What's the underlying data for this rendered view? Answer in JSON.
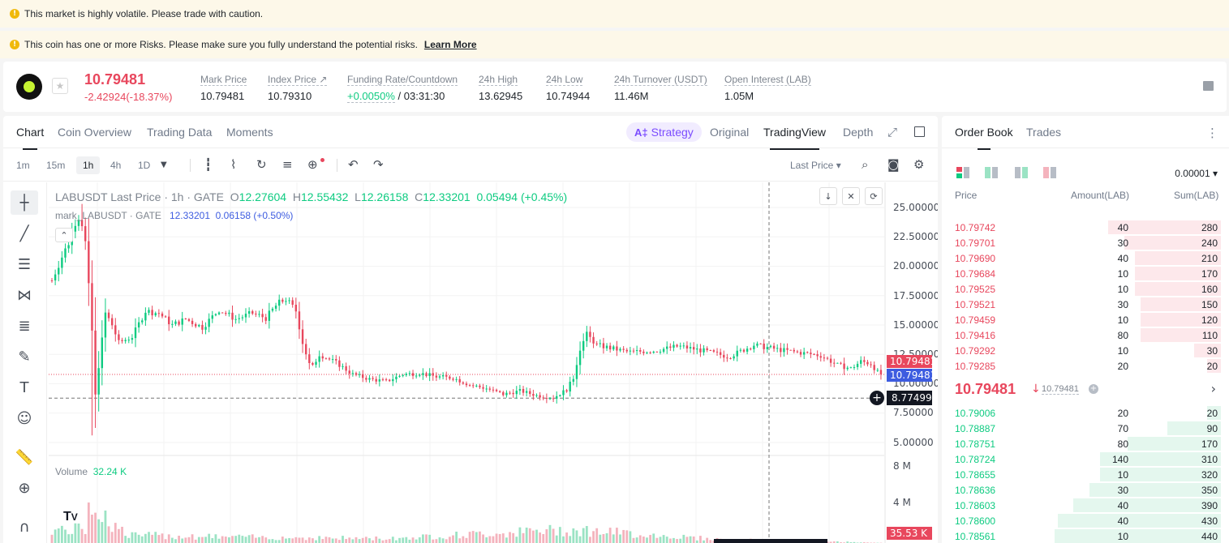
{
  "banners": {
    "volatility": "This market is highly volatile. Please trade with caution.",
    "risk": "This coin has one or more Risks. Please make sure you fully understand the potential risks.",
    "learn_more": "Learn More",
    "warn_icon": "!"
  },
  "ticker": {
    "last_price": "10.79481",
    "change": "-2.42924(-18.37%)",
    "stats": [
      {
        "label": "Mark Price",
        "value": "10.79481"
      },
      {
        "label": "Index Price ↗",
        "value": "10.79310"
      },
      {
        "label": "Funding Rate/Countdown",
        "value_rate": "+0.0050%",
        "value_countdown": "/ 03:31:30"
      },
      {
        "label": "24h High",
        "value": "13.62945"
      },
      {
        "label": "24h Low",
        "value": "10.74944"
      },
      {
        "label": "24h Turnover (USDT)",
        "value": "11.46M"
      },
      {
        "label": "Open Interest (LAB)",
        "value": "1.05M"
      }
    ],
    "star_icon": "★"
  },
  "chart_tabs": {
    "items": [
      "Chart",
      "Coin Overview",
      "Trading Data",
      "Moments"
    ],
    "strategy_ai": "A‡",
    "strategy": "Strategy",
    "views": [
      "Original",
      "TradingView",
      "Depth"
    ]
  },
  "toolbar": {
    "timeframes": [
      "1m",
      "15m",
      "1h",
      "4h",
      "1D"
    ],
    "active_timeframe": "1h",
    "price_type": "Last Price ▾"
  },
  "legend": {
    "symbol": "LABUSDT Last Price · 1h · GATE",
    "o_label": "O",
    "o": "12.27604",
    "h_label": "H",
    "h": "12.55432",
    "l_label": "L",
    "l": "12.26158",
    "c_label": "C",
    "c": "12.33201",
    "chg": "0.05494 (+0.45%)",
    "mark_symbol": "mark_LABUSDT · GATE",
    "mark_value": "12.33201",
    "mark_chg": "0.06158 (+0.50%)",
    "volume_label": "Volume",
    "volume_value": "32.24 K"
  },
  "axis": {
    "price_ticks": [
      "25.00000",
      "22.50000",
      "20.00000",
      "17.50000",
      "15.00000",
      "12.50000",
      "10.00000",
      "7.50000",
      "5.00000"
    ],
    "volume_ticks": [
      "8 M",
      "4 M"
    ],
    "last_price_tag": "10.79481",
    "mark_price_tag": "10.79481",
    "crosshair_tag": "8.77499",
    "volume_tag": "35.53 K"
  },
  "colors": {
    "up": "#0ecb81",
    "down": "#e8475d",
    "mark": "#3d5ce0"
  },
  "chart_data": {
    "type": "candlestick",
    "symbol": "LABUSDT",
    "interval": "1h",
    "ylim": [
      3.5,
      27.0
    ],
    "volume_ylim": [
      0,
      10000000
    ],
    "last_price": 10.79481,
    "crosshair_price": 8.77499,
    "last_candle": {
      "open": 12.27604,
      "high": 12.55432,
      "low": 12.26158,
      "close": 12.33201
    },
    "series_outline": [
      [
        0,
        18.8
      ],
      [
        5,
        20.5
      ],
      [
        10,
        22.0
      ],
      [
        14,
        23.8
      ],
      [
        17,
        24.5
      ],
      [
        20,
        22.0
      ],
      [
        24,
        14.5
      ],
      [
        26,
        9.0
      ],
      [
        28,
        11.5
      ],
      [
        32,
        16.0
      ],
      [
        36,
        15.0
      ],
      [
        40,
        13.5
      ],
      [
        48,
        14.0
      ],
      [
        56,
        16.2
      ],
      [
        64,
        16.0
      ],
      [
        72,
        15.0
      ],
      [
        80,
        15.5
      ],
      [
        90,
        14.8
      ],
      [
        100,
        16.3
      ],
      [
        110,
        15.5
      ],
      [
        120,
        16.0
      ],
      [
        128,
        15.6
      ],
      [
        135,
        16.8
      ],
      [
        140,
        17.2
      ],
      [
        146,
        16.2
      ],
      [
        150,
        13.5
      ],
      [
        155,
        11.2
      ],
      [
        160,
        12.5
      ],
      [
        170,
        11.8
      ],
      [
        180,
        10.8
      ],
      [
        190,
        10.4
      ],
      [
        200,
        10.2
      ],
      [
        210,
        10.8
      ],
      [
        220,
        10.9
      ],
      [
        230,
        10.6
      ],
      [
        240,
        10.5
      ],
      [
        250,
        9.9
      ],
      [
        260,
        9.6
      ],
      [
        270,
        9.1
      ],
      [
        280,
        9.4
      ],
      [
        290,
        9.0
      ],
      [
        300,
        8.8
      ],
      [
        308,
        9.5
      ],
      [
        312,
        10.5
      ],
      [
        316,
        13.0
      ],
      [
        320,
        14.2
      ],
      [
        326,
        13.3
      ],
      [
        335,
        13.0
      ],
      [
        345,
        12.7
      ],
      [
        360,
        12.8
      ],
      [
        375,
        13.2
      ],
      [
        390,
        12.8
      ],
      [
        405,
        12.3
      ],
      [
        420,
        13.3
      ],
      [
        435,
        12.9
      ],
      [
        450,
        12.6
      ],
      [
        460,
        12.4
      ],
      [
        470,
        11.6
      ],
      [
        478,
        11.3
      ],
      [
        484,
        11.9
      ],
      [
        490,
        11.7
      ],
      [
        494,
        11.0
      ],
      [
        497,
        10.79
      ]
    ],
    "volume_outline": [
      [
        20,
        7500000
      ],
      [
        22,
        6200000
      ],
      [
        25,
        4200000
      ],
      [
        30,
        3200000
      ],
      [
        45,
        900000
      ],
      [
        100,
        700000
      ],
      [
        200,
        500000
      ],
      [
        310,
        1500000
      ],
      [
        400,
        400000
      ],
      [
        497,
        35530
      ]
    ]
  },
  "order_book": {
    "tabs": [
      "Order Book",
      "Trades"
    ],
    "tick_size": "0.00001 ▾",
    "headers": [
      "Price",
      "Amount(LAB)",
      "Sum(LAB)"
    ],
    "asks": [
      {
        "price": "10.79742",
        "amount": "40",
        "sum": "280",
        "depth": 0.42
      },
      {
        "price": "10.79701",
        "amount": "30",
        "sum": "240",
        "depth": 0.36
      },
      {
        "price": "10.79690",
        "amount": "40",
        "sum": "210",
        "depth": 0.32
      },
      {
        "price": "10.79684",
        "amount": "10",
        "sum": "170",
        "depth": 0.32
      },
      {
        "price": "10.79525",
        "amount": "10",
        "sum": "160",
        "depth": 0.32
      },
      {
        "price": "10.79521",
        "amount": "30",
        "sum": "150",
        "depth": 0.3
      },
      {
        "price": "10.79459",
        "amount": "10",
        "sum": "120",
        "depth": 0.3
      },
      {
        "price": "10.79416",
        "amount": "80",
        "sum": "110",
        "depth": 0.3
      },
      {
        "price": "10.79292",
        "amount": "10",
        "sum": "30",
        "depth": 0.1
      },
      {
        "price": "10.79285",
        "amount": "20",
        "sum": "20",
        "depth": 0.05
      }
    ],
    "mid": {
      "price": "10.79481",
      "arrow": "↓",
      "mark": "10.79481",
      "more": "›"
    },
    "bids": [
      {
        "price": "10.79006",
        "amount": "20",
        "sum": "20",
        "depth": 0.05
      },
      {
        "price": "10.78887",
        "amount": "70",
        "sum": "90",
        "depth": 0.2
      },
      {
        "price": "10.78751",
        "amount": "80",
        "sum": "170",
        "depth": 0.35
      },
      {
        "price": "10.78724",
        "amount": "140",
        "sum": "310",
        "depth": 0.45
      },
      {
        "price": "10.78655",
        "amount": "10",
        "sum": "320",
        "depth": 0.45
      },
      {
        "price": "10.78636",
        "amount": "30",
        "sum": "350",
        "depth": 0.49
      },
      {
        "price": "10.78603",
        "amount": "40",
        "sum": "390",
        "depth": 0.55
      },
      {
        "price": "10.78600",
        "amount": "40",
        "sum": "430",
        "depth": 0.61
      },
      {
        "price": "10.78561",
        "amount": "10",
        "sum": "440",
        "depth": 0.62
      }
    ]
  }
}
